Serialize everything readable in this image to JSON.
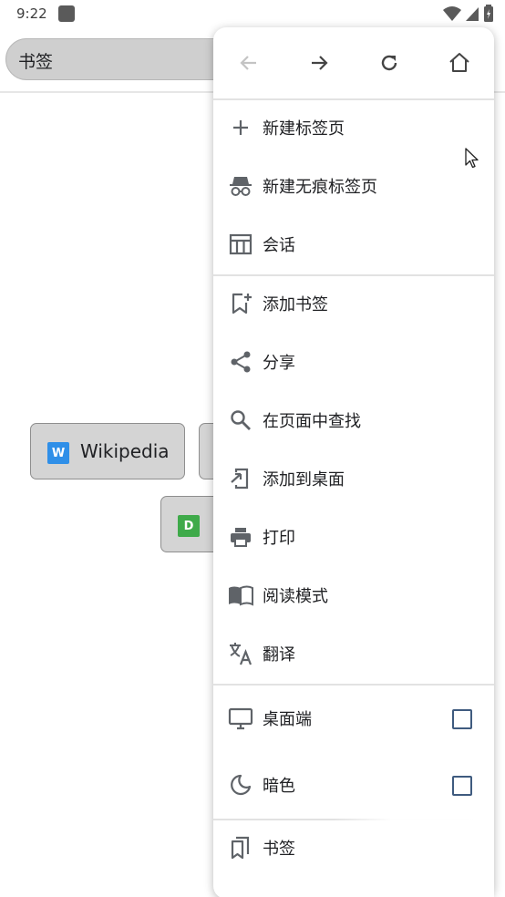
{
  "status_bar": {
    "time": "9:22"
  },
  "url_bar": {
    "text": "书签"
  },
  "speed_dial": [
    {
      "label": "Wikipedia",
      "favicon_letter": "W",
      "favicon_color": "#2f8fe8"
    },
    {
      "label": "",
      "favicon_letter": "D",
      "favicon_color": "#3faa4a"
    }
  ],
  "menu": {
    "nav": {
      "back_icon": "arrow-left-icon",
      "forward_icon": "arrow-right-icon",
      "reload_icon": "reload-icon",
      "home_icon": "home-icon"
    },
    "items": [
      {
        "label": "新建标签页",
        "icon": "plus-icon"
      },
      {
        "label": "新建无痕标签页",
        "icon": "incognito-icon"
      },
      {
        "label": "会话",
        "icon": "sessions-icon"
      },
      {
        "label": "添加书签",
        "icon": "bookmark-add-icon"
      },
      {
        "label": "分享",
        "icon": "share-icon"
      },
      {
        "label": "在页面中查找",
        "icon": "search-icon"
      },
      {
        "label": "添加到桌面",
        "icon": "add-to-home-icon"
      },
      {
        "label": "打印",
        "icon": "print-icon"
      },
      {
        "label": "阅读模式",
        "icon": "book-icon"
      },
      {
        "label": "翻译",
        "icon": "translate-icon"
      },
      {
        "label": "桌面端",
        "icon": "desktop-icon",
        "checked": false
      },
      {
        "label": "暗色",
        "icon": "moon-icon",
        "checked": false
      },
      {
        "label": "书签",
        "icon": "bookmarks-icon"
      }
    ]
  },
  "colors": {
    "accent": "#3f5b7f",
    "icon": "#5f6368",
    "tile_bg": "#d4d4d4"
  }
}
